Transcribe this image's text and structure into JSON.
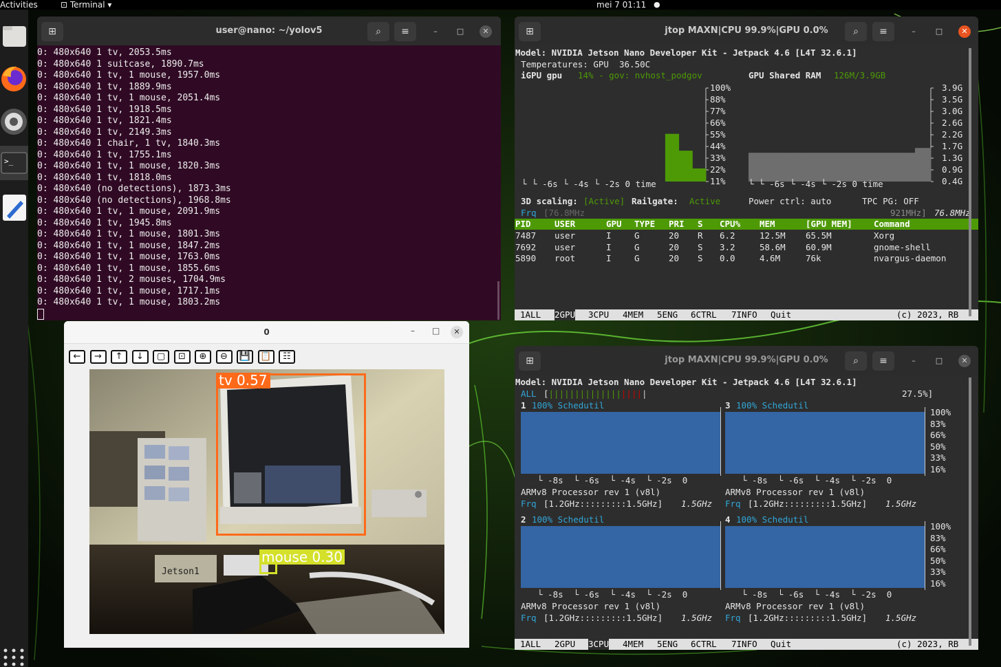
{
  "topbar": {
    "activities": "Activities",
    "app": "Terminal",
    "clock": "mei 7  01:11"
  },
  "dock": {
    "items": [
      {
        "name": "files-icon"
      },
      {
        "name": "firefox-icon"
      },
      {
        "name": "settings-icon"
      },
      {
        "name": "terminal-icon"
      },
      {
        "name": "text-editor-icon"
      }
    ],
    "apps_grid": "apps-grid-icon"
  },
  "terminal": {
    "title": "user@nano: ~/yolov5",
    "lines": [
      "0: 480x640 1 tv, 2053.5ms",
      "0: 480x640 1 suitcase, 1890.7ms",
      "0: 480x640 1 tv, 1 mouse, 1957.0ms",
      "0: 480x640 1 tv, 1889.9ms",
      "0: 480x640 1 tv, 1 mouse, 2051.4ms",
      "0: 480x640 1 tv, 1918.5ms",
      "0: 480x640 1 tv, 1821.4ms",
      "0: 480x640 1 tv, 2149.3ms",
      "0: 480x640 1 chair, 1 tv, 1840.3ms",
      "0: 480x640 1 tv, 1755.1ms",
      "0: 480x640 1 tv, 1 mouse, 1820.3ms",
      "0: 480x640 1 tv, 1818.0ms",
      "0: 480x640 (no detections), 1873.3ms",
      "0: 480x640 (no detections), 1968.8ms",
      "0: 480x640 1 tv, 1 mouse, 2091.9ms",
      "0: 480x640 1 tv, 1945.8ms",
      "0: 480x640 1 tv, 1 mouse, 1801.3ms",
      "0: 480x640 1 tv, 1 mouse, 1847.2ms",
      "0: 480x640 1 tv, 1 mouse, 1763.0ms",
      "0: 480x640 1 tv, 1 mouse, 1855.6ms",
      "0: 480x640 1 tv, 2 mouses, 1704.9ms",
      "0: 480x640 1 tv, 1 mouse, 1717.1ms",
      "0: 480x640 1 tv, 1 mouse, 1803.2ms"
    ]
  },
  "viewer": {
    "title": "0",
    "toolbar": [
      "arrow-left-icon",
      "arrow-right-icon",
      "arrow-up-icon",
      "arrow-down-icon",
      "zoom-fit-icon",
      "zoom-region-icon",
      "zoom-in-icon",
      "zoom-out-icon",
      "save-icon",
      "clipboard-icon",
      "properties-icon"
    ],
    "detections": [
      {
        "label": "tv  0.57",
        "color": "#ff6a1a"
      },
      {
        "label": "mouse  0.30",
        "color": "#d4e02a"
      }
    ],
    "stickers": {
      "device": "Jetson1"
    }
  },
  "jtop_gpu": {
    "title": "jtop MAXN|CPU 99.9%|GPU 0.0%",
    "model": "Model: NVIDIA Jetson Nano Developer Kit - Jetpack 4.6 [L4T 32.6.1]",
    "temps": "Temperatures: GPU  36.50C",
    "igpu_label": "iGPU gpu",
    "igpu_info": "14% - gov: nvhost_podgov",
    "shared_label": "GPU Shared RAM",
    "shared_info": "126M/3.9GB",
    "gpu_axis": [
      "100%",
      "88%",
      "77%",
      "66%",
      "55%",
      "44%",
      "33%",
      "22%",
      "11%"
    ],
    "ram_axis": [
      "3.9G",
      "3.5G",
      "3.0G",
      "2.6G",
      "2.2G",
      "1.7G",
      "1.3G",
      "0.9G",
      "0.4G"
    ],
    "gpu_time": "└   └ -6s  └ -4s   └ -2s   0 time",
    "ram_time": "└       └ -6s   └ -4s   └ -2s   0 time",
    "scaling_label": "3D scaling:",
    "scaling_val": "[Active]",
    "railgate_label": "Railgate:",
    "railgate_val": "Active",
    "power": "Power ctrl: auto",
    "tpc": "TPC PG: OFF",
    "frq_label": "Frq",
    "frq_min": "[76.8MHz",
    "frq_max": "921MHz]",
    "frq_cur": "76.8MHz",
    "table_headers": [
      "PID",
      "USER",
      "GPU",
      "TYPE",
      "PRI",
      "S",
      "CPU%",
      "MEM",
      "[GPU MEM]",
      "Command"
    ],
    "rows": [
      [
        "7487",
        "user",
        "I",
        "G",
        "20",
        "R",
        "6.2",
        "12.5M",
        "65.5M",
        "Xorg"
      ],
      [
        "7692",
        "user",
        "I",
        "G",
        "20",
        "S",
        "3.2",
        "58.6M",
        "60.9M",
        "gnome-shell"
      ],
      [
        "5890",
        "root",
        "I",
        "G",
        "20",
        "S",
        "0.0",
        "4.6M",
        "76k",
        "nvargus-daemon"
      ]
    ],
    "tabs": [
      "1ALL",
      "2GPU",
      "3CPU",
      "4MEM",
      "5ENG",
      "6CTRL",
      "7INFO",
      "Quit"
    ],
    "active_tab": 1,
    "copyright": "(c) 2023, RB",
    "gpu_load_pct": [
      0,
      0,
      0,
      0,
      0,
      0,
      0,
      0,
      0,
      0,
      0,
      0,
      0,
      0,
      0,
      0,
      0,
      0,
      0,
      0,
      0,
      51,
      51,
      33,
      33,
      14,
      14
    ],
    "ram_levels_gb": [
      1.2,
      1.2,
      1.2,
      1.2,
      1.2,
      1.2,
      1.2,
      1.2,
      1.2,
      1.2,
      1.2,
      1.2,
      1.2,
      1.2,
      1.2,
      1.2,
      1.2,
      1.2,
      1.2,
      1.2,
      1.2,
      1.4,
      1.4
    ]
  },
  "jtop_cpu": {
    "title": "jtop MAXN|CPU 99.9%|GPU 0.0%",
    "model": "Model: NVIDIA Jetson Nano Developer Kit - Jetpack 4.6 [L4T 32.6.1]",
    "all_label": "ALL",
    "all_val": "27.5%]",
    "cores": [
      {
        "id": "1",
        "info": "100% Schedutil"
      },
      {
        "id": "3",
        "info": "100% Schedutil"
      },
      {
        "id": "2",
        "info": "100% Schedutil"
      },
      {
        "id": "4",
        "info": "100% Schedutil"
      }
    ],
    "axis": [
      "100%",
      "83%",
      "66%",
      "50%",
      "33%",
      "16%"
    ],
    "time": "└ -8s  └ -6s  └ -4s  └ -2s  0",
    "proc": "ARMv8 Processor rev 1 (v8l)",
    "frq_label": "Frq",
    "frq_range": "[1.2GHz:::::::::1.5GHz]",
    "frq_cur": "1.5GHz",
    "tabs": [
      "1ALL",
      "2GPU",
      "3CPU",
      "4MEM",
      "5ENG",
      "6CTRL",
      "7INFO",
      "Quit"
    ],
    "active_tab": 2,
    "copyright": "(c) 2023, RB"
  }
}
